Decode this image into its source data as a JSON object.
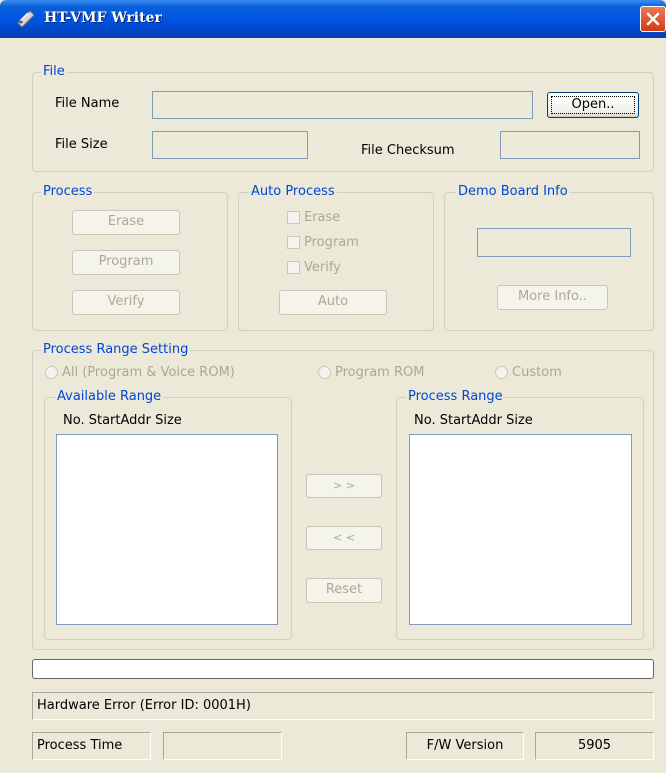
{
  "window": {
    "title": "HT-VMF Writer",
    "title_icon": "writer-app-icon",
    "close_icon": "close-icon"
  },
  "file": {
    "group_label": "File",
    "file_name_label": "File Name",
    "file_name_value": "",
    "open_button": "Open..",
    "file_size_label": "File Size",
    "file_size_value": "",
    "file_checksum_label": "File Checksum",
    "file_checksum_value": ""
  },
  "process": {
    "group_label": "Process",
    "erase_button": "Erase",
    "program_button": "Program",
    "verify_button": "Verify"
  },
  "auto_process": {
    "group_label": "Auto Process",
    "erase_label": "Erase",
    "program_label": "Program",
    "verify_label": "Verify",
    "erase_checked": false,
    "program_checked": false,
    "verify_checked": false,
    "auto_button": "Auto"
  },
  "demo_board": {
    "group_label": "Demo Board Info",
    "info_value": "",
    "more_info_button": "More Info.."
  },
  "range_setting": {
    "group_label": "Process Range Setting",
    "options": [
      "All (Program & Voice ROM)",
      "Program ROM",
      "Custom"
    ],
    "available": {
      "group_label": "Available Range",
      "header": "No. StartAddr Size",
      "items": []
    },
    "process_range": {
      "group_label": "Process Range",
      "header": "No. StartAddr Size",
      "items": []
    },
    "add_button": "> >",
    "remove_button": "< <",
    "reset_button": "Reset"
  },
  "progress": {
    "value": 0
  },
  "status": {
    "message": "Hardware Error (Error ID: 0001H)",
    "process_time_label": "Process Time",
    "process_time_value": "",
    "fw_version_label": "F/W Version",
    "fw_version_value": "5905"
  },
  "colors": {
    "titlebar": "#0055e5",
    "window_bg": "#ece9d8",
    "group_label": "#0046d5",
    "disabled_text": "#aca899"
  }
}
